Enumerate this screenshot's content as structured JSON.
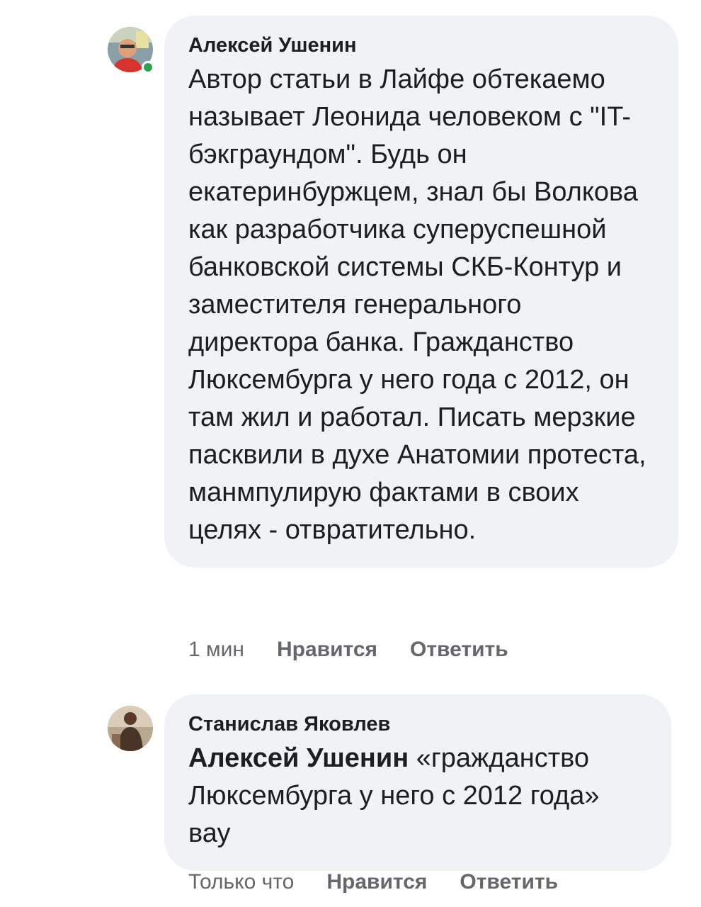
{
  "comments": [
    {
      "author": "Алексей Ушенин",
      "online": true,
      "text": "Автор статьи в Лайфе обтекаемо называет Леонида человеком с \"IT-бэкграундом\". Будь он екатеринбуржцем, знал бы Волкова как разработчика суперуспешной банковской системы СКБ-Контур и заместителя генерального директора банка. Гражданство Люксембурга у него года с 2012, он там жил и работал. Писать мерзкие пасквили в духе Анатомии протеста, манмпулирую фактами в своих целях - отвратительно.",
      "time": "1 мин",
      "like_label": "Нравится",
      "reply_label": "Ответить",
      "avatar_icon": "user-photo-avatar"
    },
    {
      "author": "Станислав Яковлев",
      "online": false,
      "mention": "Алексей Ушенин",
      "text": " «гражданство Люксембурга у него с 2012 года» вау",
      "time": "Только что",
      "like_label": "Нравится",
      "reply_label": "Ответить",
      "avatar_icon": "user-photo-avatar"
    }
  ],
  "colors": {
    "bubble_bg": "#f0f2f5",
    "text": "#1c1e21",
    "meta": "#65676b",
    "online": "#31a24c"
  }
}
